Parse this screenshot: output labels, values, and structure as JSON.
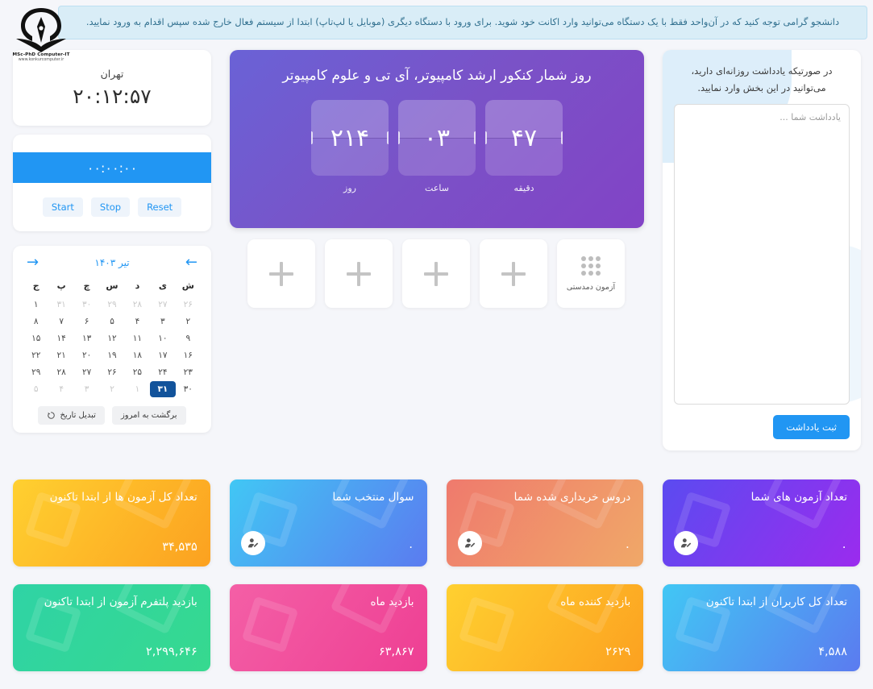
{
  "banner": {
    "text": "دانشجو گرامی توجه کنید که در آن‌واحد فقط با یک دستگاه می‌توانید وارد اکانت خود شوید. برای ورود با دستگاه دیگری (موبایل یا لپ‌تاپ) ابتدا از سیستم فعال خارج شده سپس اقدام به ورود نمایید.",
    "accent": "#31708f",
    "background": "#d9edf7"
  },
  "logo": {
    "line1": "MSc-PhD Computer-IT",
    "line2": "www.konkurcomputer.ir",
    "icon": "pen-book-logo"
  },
  "clock": {
    "city": "تهران",
    "time": "۲۰:۱۲:۵۷"
  },
  "timer": {
    "value": "۰۰:۰۰:۰۰",
    "strip_color": "#2196f3",
    "buttons": [
      {
        "label": "Reset",
        "name": "reset"
      },
      {
        "label": "Stop",
        "name": "stop"
      },
      {
        "label": "Start",
        "name": "start"
      }
    ]
  },
  "calendar": {
    "title": "تیر ۱۴۰۳",
    "prev_icon": "arrow-right-icon",
    "next_icon": "arrow-left-icon",
    "weekdays": [
      "ش",
      "ی",
      "د",
      "س",
      "چ",
      "پ",
      "ج"
    ],
    "today": "۳۱",
    "accent": "#2196f3",
    "today_bg": "#12539b",
    "weeks": [
      [
        {
          "d": "۲۶",
          "muted": true
        },
        {
          "d": "۲۷",
          "muted": true
        },
        {
          "d": "۲۸",
          "muted": true
        },
        {
          "d": "۲۹",
          "muted": true
        },
        {
          "d": "۳۰",
          "muted": true
        },
        {
          "d": "۳۱",
          "muted": true
        },
        {
          "d": "۱",
          "muted": false
        }
      ],
      [
        {
          "d": "۲",
          "muted": false
        },
        {
          "d": "۳",
          "muted": false
        },
        {
          "d": "۴",
          "muted": false
        },
        {
          "d": "۵",
          "muted": false
        },
        {
          "d": "۶",
          "muted": false
        },
        {
          "d": "۷",
          "muted": false
        },
        {
          "d": "۸",
          "muted": false
        }
      ],
      [
        {
          "d": "۹",
          "muted": false
        },
        {
          "d": "۱۰",
          "muted": false
        },
        {
          "d": "۱۱",
          "muted": false
        },
        {
          "d": "۱۲",
          "muted": false
        },
        {
          "d": "۱۳",
          "muted": false
        },
        {
          "d": "۱۴",
          "muted": false
        },
        {
          "d": "۱۵",
          "muted": false
        }
      ],
      [
        {
          "d": "۱۶",
          "muted": false
        },
        {
          "d": "۱۷",
          "muted": false
        },
        {
          "d": "۱۸",
          "muted": false
        },
        {
          "d": "۱۹",
          "muted": false
        },
        {
          "d": "۲۰",
          "muted": false
        },
        {
          "d": "۲۱",
          "muted": false
        },
        {
          "d": "۲۲",
          "muted": false
        }
      ],
      [
        {
          "d": "۲۳",
          "muted": false
        },
        {
          "d": "۲۴",
          "muted": false
        },
        {
          "d": "۲۵",
          "muted": false
        },
        {
          "d": "۲۶",
          "muted": false
        },
        {
          "d": "۲۷",
          "muted": false
        },
        {
          "d": "۲۸",
          "muted": false
        },
        {
          "d": "۲۹",
          "muted": false
        }
      ],
      [
        {
          "d": "۳۰",
          "muted": false
        },
        {
          "d": "۳۱",
          "muted": false,
          "today": true
        },
        {
          "d": "۱",
          "muted": true
        },
        {
          "d": "۲",
          "muted": true
        },
        {
          "d": "۳",
          "muted": true
        },
        {
          "d": "۴",
          "muted": true
        },
        {
          "d": "۵",
          "muted": true
        }
      ]
    ],
    "footer": {
      "today_button": "برگشت به امروز",
      "convert_button": "تبدیل تاریخ",
      "convert_icon": "refresh-icon"
    }
  },
  "countdown": {
    "title": "روز شمار کنکور ارشد کامپیوتر، آی تی و علوم کامپیوتر",
    "units": [
      {
        "value": "۴۷",
        "label": "دقیقه"
      },
      {
        "value": "۰۳",
        "label": "ساعت"
      },
      {
        "value": "۲۱۴",
        "label": "روز"
      }
    ]
  },
  "tiles": [
    {
      "type": "exam",
      "icon": "dot-grid-icon",
      "label": "آزمون دمدستی"
    },
    {
      "type": "add",
      "icon": "plus-icon",
      "label": ""
    },
    {
      "type": "add",
      "icon": "plus-icon",
      "label": ""
    },
    {
      "type": "add",
      "icon": "plus-icon",
      "label": ""
    },
    {
      "type": "add",
      "icon": "plus-icon",
      "label": ""
    }
  ],
  "notes": {
    "intro": "در صورتیکه یادداشت روزانه‌ای دارید، می‌توانید در این بخش وارد نمایید.",
    "placeholder": "یادداشت شما ...",
    "value": "",
    "submit_label": "ثبت یادداشت",
    "submit_color": "#2196f3"
  },
  "stats": [
    {
      "title": "تعداد آزمون های شما",
      "value": "۰",
      "icon": "user-edit-icon",
      "has_avatar": true,
      "gradient": "linear-gradient(125deg, #5b4bf0 0%, #9b2bee 100%)"
    },
    {
      "title": "دروس خریداری شده شما",
      "value": "۰",
      "icon": "user-edit-icon",
      "has_avatar": true,
      "gradient": "linear-gradient(125deg, #ef7a6d 0%, #f0a868 100%)"
    },
    {
      "title": "سوال منتخب شما",
      "value": "۰",
      "icon": "user-edit-icon",
      "has_avatar": true,
      "gradient": "linear-gradient(125deg, #41c7f4 0%, #5b7bf0 100%)"
    },
    {
      "title": "تعداد کل آزمون ها از ابتدا تاکنون",
      "value": "۳۴,۵۳۵",
      "icon": "",
      "has_avatar": false,
      "gradient": "linear-gradient(125deg, #ffd030 0%, #fca120 100%)"
    },
    {
      "title": "تعداد کل کاربران از ابتدا تاکنون",
      "value": "۴,۵۸۸",
      "icon": "",
      "has_avatar": false,
      "gradient": "linear-gradient(125deg, #41c7f4 0%, #5b7bf0 100%)"
    },
    {
      "title": "بازدید کننده ماه",
      "value": "۲۶۲۹",
      "icon": "",
      "has_avatar": false,
      "gradient": "linear-gradient(125deg, #ffd030 0%, #fca120 100%)"
    },
    {
      "title": "بازدید ماه",
      "value": "۶۳,۸۶۷",
      "icon": "",
      "has_avatar": false,
      "gradient": "linear-gradient(125deg, #f45fa6 0%, #ee3f93 100%)"
    },
    {
      "title": "بازدید پلتفرم آزمون از ابتدا تاکنون",
      "value": "۲,۲۹۹,۶۴۶",
      "icon": "",
      "has_avatar": false,
      "gradient": "linear-gradient(125deg, #2fd3a5 0%, #36d98f 100%)"
    }
  ]
}
